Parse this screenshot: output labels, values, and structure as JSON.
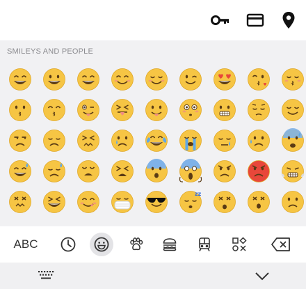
{
  "top_icons": [
    "key-icon",
    "credit-card-icon",
    "location-pin-icon"
  ],
  "section_label": "SMILEYS AND PEOPLE",
  "colors": {
    "emoji_face": "#f6c544",
    "blush": "#f28b82",
    "accent_red": "#e8473a"
  },
  "emojis": [
    "grinning-face",
    "smiling-face-open-mouth",
    "smiling-face-smiling-eyes",
    "smiling-face",
    "relaxed-face",
    "winking-face",
    "heart-eyes-face",
    "face-blowing-kiss",
    "kissing-face-closed-eyes",
    "kissing-face",
    "kissing-face-smiling-eyes",
    "winking-face-tongue",
    "squinting-face-tongue",
    "face-with-tongue",
    "flushed-face",
    "grimacing-face",
    "pensive-face",
    "relieved-face",
    "unamused-face",
    "disappointed-face",
    "persevering-face",
    "crying-face",
    "face-with-tears-of-joy",
    "loudly-crying-face",
    "sleepy-face",
    "sad-but-relieved-face",
    "anxious-face-sweat",
    "grinning-face-sweat",
    "downcast-face-sweat",
    "weary-face",
    "tired-face",
    "fearful-face",
    "screaming-face",
    "angry-face",
    "pouting-face",
    "face-with-steam",
    "confounded-face",
    "squinting-laughing-face",
    "face-savoring-food",
    "face-with-medical-mask",
    "smiling-face-sunglasses",
    "sleeping-face",
    "dizzy-face",
    "astonished-face",
    "frowning-face",
    "partial-face",
    "partial-face",
    "imp",
    "smiling-imp",
    "partial-face",
    "partial-face",
    "partial-face",
    "partial-face",
    "partial-face"
  ],
  "tabs": {
    "abc_label": "ABC",
    "icons": [
      "clock-icon",
      "smiley-icon",
      "paw-icon",
      "burger-icon",
      "train-icon",
      "symbols-icon",
      "backspace-icon"
    ]
  },
  "bottom_icons": [
    "keyboard-icon",
    "chevron-down-icon"
  ]
}
